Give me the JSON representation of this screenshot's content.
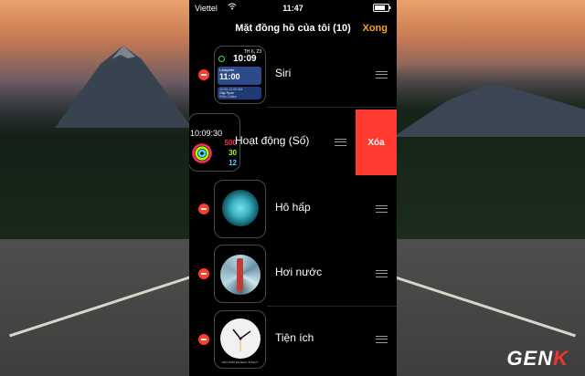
{
  "status_bar": {
    "carrier": "Viettel",
    "time": "11:47",
    "battery_icon": "battery-icon",
    "wifi_icon": "wifi-icon"
  },
  "nav": {
    "title": "Mặt đồng hồ của tôi (10)",
    "done_label": "Xong"
  },
  "faces": [
    {
      "label": "Siri",
      "preview": {
        "date": "TH 6, 23",
        "time": "10:09",
        "card1_title": "Lafayette",
        "card1_time": "11:00",
        "card2_lines": [
          "10:30–11:00 AM",
          "Gặp Ryan",
          "Philz Coffee"
        ]
      }
    },
    {
      "label": "Hoạt động (Số)",
      "delete_label": "Xóa",
      "preview": {
        "time": "10:09:30",
        "move": "500",
        "exercise": "30",
        "stand": "12"
      }
    },
    {
      "label": "Hô hấp"
    },
    {
      "label": "Hơi nước"
    },
    {
      "label": "Tiện ích",
      "preview": {
        "footer": "MẶT TRỜI ĐÃ MỌC: 8 PHÚT"
      }
    }
  ],
  "colors": {
    "accent": "#f7a21b",
    "delete": "#ff3b30"
  },
  "watermark": {
    "text_main": "GEN",
    "text_accent": "K"
  }
}
